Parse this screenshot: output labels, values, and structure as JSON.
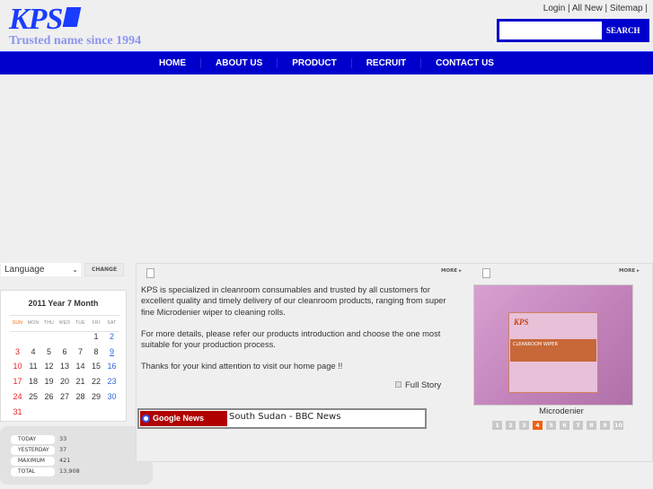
{
  "header": {
    "logo_text": "KPS",
    "tagline": "Trusted name since 1994",
    "links": [
      "Login",
      "All New",
      "Sitemap"
    ],
    "search_placeholder": "",
    "search_label": "SEARCH"
  },
  "nav": [
    "HOME",
    "ABOUT US",
    "PRODUCT",
    "RECRUIT",
    "CONTACT US"
  ],
  "language": {
    "selected": "Language",
    "change_label": "CHANGE"
  },
  "calendar": {
    "title": "2011 Year 7 Month",
    "days": [
      "SUN",
      "MON",
      "THU",
      "WED",
      "TUE",
      "FRI",
      "SAT"
    ],
    "first_weekday": 5,
    "num_days": 31,
    "highlight_day": 9,
    "colors": {
      "sunday": "#ee2222",
      "saturday": "#3366dd",
      "sun_header": "#ff6600"
    }
  },
  "stats": [
    {
      "label": "TODAY",
      "value": "33"
    },
    {
      "label": "YESTERDAY",
      "value": "37"
    },
    {
      "label": "MAXIMUM",
      "value": "421"
    },
    {
      "label": "TOTAL",
      "value": "13,908"
    }
  ],
  "intro": {
    "more_label": "MORE",
    "paragraphs": [
      "KPS is specialized in cleanroom consumables and trusted by all customers for excellent quality and timely delivery of our cleanroom products, ranging from super fine Microdenier wiper to cleaning rolls.",
      "For more details, please refer our products introduction and choose the one most suitable for your production process.",
      "Thanks for your kind attention to visit our home page !!"
    ],
    "full_story": "Full Story"
  },
  "google_news": {
    "badge": "Google News",
    "headline": "South Sudan - BBC News"
  },
  "product": {
    "more_label": "MORE",
    "image_logo": "KPS",
    "image_band": "CLEANROOM WIPER",
    "name": "Microdenier",
    "pages": [
      "1",
      "2",
      "3",
      "4",
      "5",
      "6",
      "7",
      "8",
      "9",
      "10"
    ],
    "active_page": "4"
  },
  "colors": {
    "brand_blue": "#0000cc",
    "pager_active": "#f06010",
    "news_red": "#b00000"
  }
}
